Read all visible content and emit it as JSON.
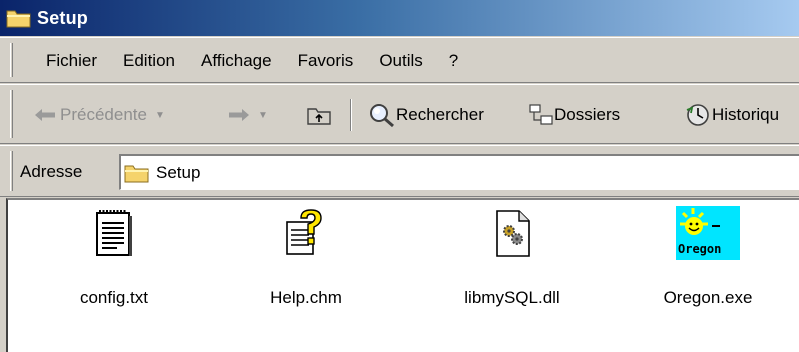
{
  "window": {
    "title": "Setup"
  },
  "menu": {
    "items": [
      {
        "label": "Fichier"
      },
      {
        "label": "Edition"
      },
      {
        "label": "Affichage"
      },
      {
        "label": "Favoris"
      },
      {
        "label": "Outils"
      },
      {
        "label": "?"
      }
    ]
  },
  "toolbar": {
    "back_label": "Précédente",
    "search_label": "Rechercher",
    "folders_label": "Dossiers",
    "history_label": "Historiqu"
  },
  "address": {
    "label": "Adresse",
    "value": "Setup"
  },
  "files": [
    {
      "name": "config.txt",
      "icon": "text-file-icon"
    },
    {
      "name": "Help.chm",
      "icon": "help-file-icon"
    },
    {
      "name": "libmySQL.dll",
      "icon": "dll-file-icon"
    },
    {
      "name": "Oregon.exe",
      "icon": "oregon-app-icon",
      "icon_text": "Oregon"
    }
  ],
  "colors": {
    "title_start": "#0a246a",
    "title_end": "#a6caf0",
    "chrome": "#d4d0c8",
    "folder": "#f5d36b",
    "oregon_bg": "#00e5ff",
    "oregon_sun": "#ffff00"
  }
}
